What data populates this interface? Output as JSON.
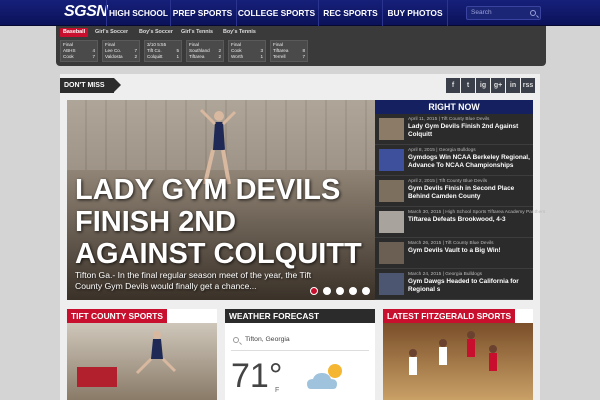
{
  "nav": {
    "logo": "SGSN",
    "items": [
      "HIGH SCHOOL",
      "PREP SPORTS",
      "COLLEGE SPORTS",
      "REC SPORTS",
      "BUY PHOTOS"
    ],
    "search_placeholder": "Search"
  },
  "scores": {
    "tabs": [
      "Baseball",
      "Girl's Soccer",
      "Boy's Soccer",
      "Girl's Tennis",
      "Boy's Tennis"
    ],
    "active_tab": "Baseball",
    "cards": [
      {
        "status": "Final",
        "t1": "ABHS",
        "s1": "4",
        "t2": "Cook",
        "s2": "7"
      },
      {
        "status": "Final",
        "t1": "Lee Co.",
        "s1": "7",
        "t2": "Valdosta",
        "s2": "2"
      },
      {
        "status": "3/10 5:55",
        "t1": "Tift Co.",
        "s1": "5",
        "t2": "Colquitt",
        "s2": "1"
      },
      {
        "status": "Final",
        "t1": "Southland",
        "s1": "2",
        "t2": "Tiftarea",
        "s2": "2"
      },
      {
        "status": "Final",
        "t1": "Cook",
        "s1": "3",
        "t2": "Worth",
        "s2": "1"
      },
      {
        "status": "Final",
        "t1": "Tiftarea",
        "s1": "8",
        "t2": "Terrell",
        "s2": "7"
      }
    ]
  },
  "dont_miss": "DON'T MISS",
  "social": [
    "f",
    "t",
    "ig",
    "g+",
    "in",
    "rss"
  ],
  "hero": {
    "title": "LADY GYM DEVILS FINISH 2ND AGAINST COLQUITT",
    "excerpt": "Tifton Ga.- In the final regular season meet of the year, the Tift County Gym Devils would finally get a chance..."
  },
  "right_now": {
    "header": "RIGHT NOW",
    "items": [
      {
        "meta": "April 11, 2015 | Tift County Blue Devils",
        "title": "Lady Gym Devils Finish 2nd Against Colquitt"
      },
      {
        "meta": "April 8, 2015 | Georgia Bulldogs",
        "title": "Gymdogs Win NCAA Berkeley Regional, Advance To NCAA Championships"
      },
      {
        "meta": "April 2, 2015 | Tift County Blue Devils",
        "title": "Gym Devils Finish in Second Place Behind Camden County"
      },
      {
        "meta": "March 30, 2015 | High School Sports Tiftarea Academy Panthers",
        "title": "Tiftarea Defeats Brookwood, 4-3"
      },
      {
        "meta": "March 26, 2015 | Tift County Blue Devils",
        "title": "Gym Devils Vault to a Big Win!"
      },
      {
        "meta": "March 24, 2015 | Georgia Bulldogs",
        "title": "Gym Dawgs Headed to California for Regional s"
      }
    ]
  },
  "panels": {
    "tift": "TIFT COUNTY SPORTS",
    "weather": "WEATHER FORECAST",
    "fitz": "LATEST FITZGERALD SPORTS"
  },
  "weather": {
    "location": "Tifton, Georgia",
    "temp": "71°",
    "unit": "F"
  },
  "colors": {
    "nav_blue": "#16207a",
    "accent_red": "#c8102e"
  }
}
